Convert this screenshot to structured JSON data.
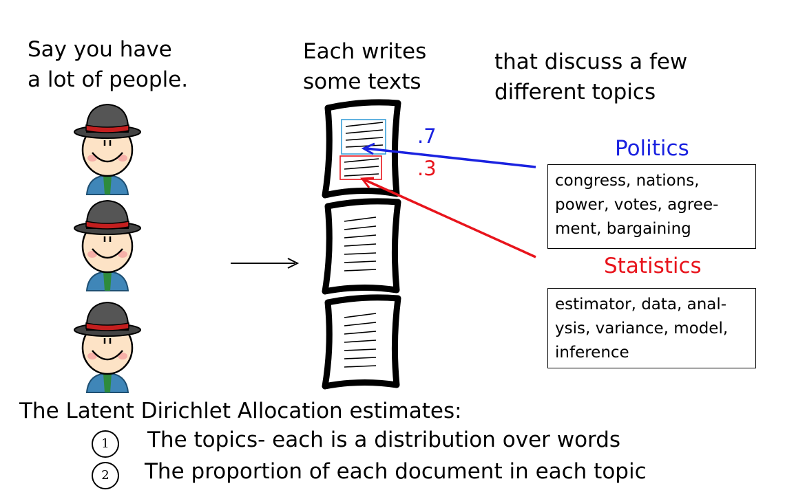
{
  "left_caption": {
    "line1": "Say you have",
    "line2": "a lot of people."
  },
  "middle_caption": {
    "line1": "Each writes",
    "line2": "some texts"
  },
  "right_caption": {
    "line1": "that discuss a few",
    "line2": "different topics"
  },
  "topics": [
    {
      "title": "Politics",
      "color": "#1a22e0",
      "proportion": ".7",
      "words": [
        "congress, nations,",
        "power, votes, agree-",
        "ment, bargaining"
      ]
    },
    {
      "title": "Statistics",
      "color": "#e8141c",
      "proportion": ".3",
      "words": [
        "estimator, data, anal-",
        "ysis, variance, model,",
        "inference"
      ]
    }
  ],
  "summary": {
    "heading": "The Latent Dirichlet Allocation estimates:",
    "items": [
      {
        "num": "1",
        "text": "The topics- each is a distribution over words"
      },
      {
        "num": "2",
        "text": "The proportion of each document in each topic"
      }
    ]
  }
}
